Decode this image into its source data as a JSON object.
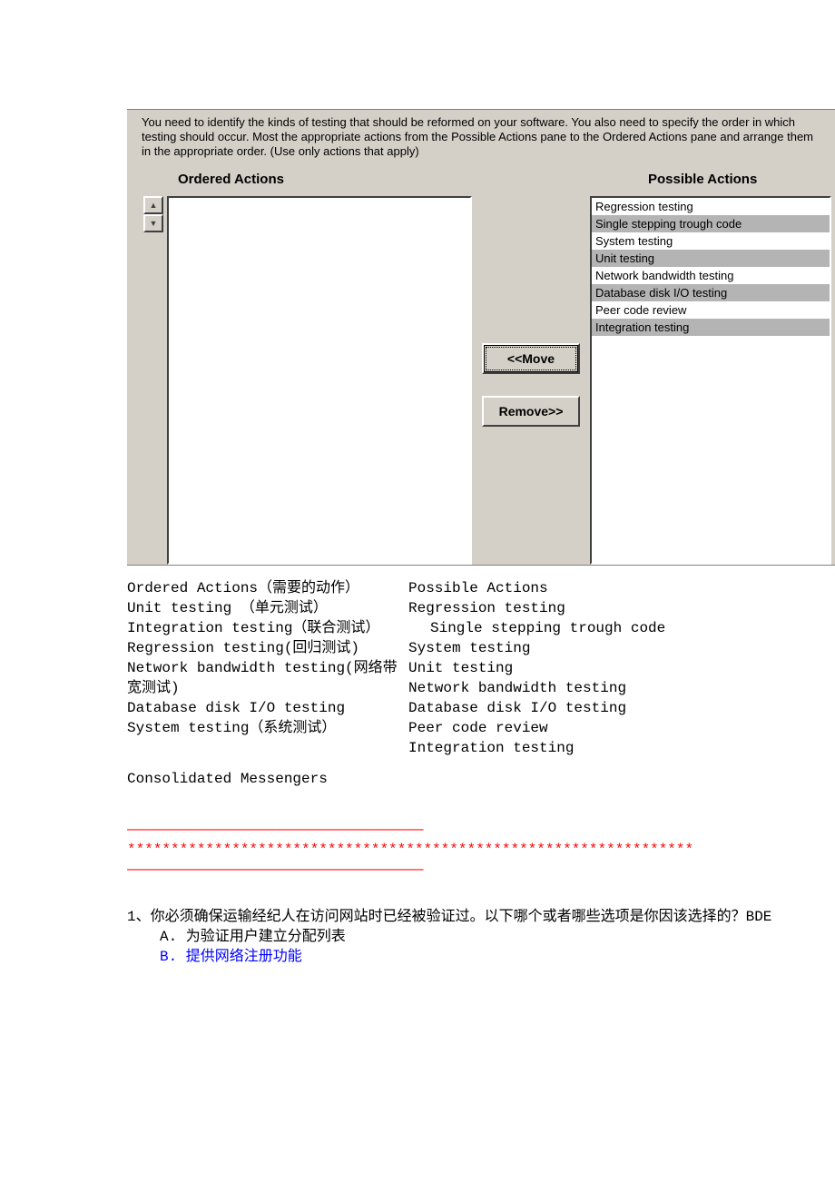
{
  "app": {
    "instructions": "You need to identify the kinds of testing that should be reformed on your software. You also need to specify the order in which testing should occur. Most the appropriate actions from the Possible Actions pane to the Ordered Actions pane and arrange them in the appropriate order. (Use only actions that apply)",
    "orderedHeader": "Ordered Actions",
    "possibleHeader": "Possible Actions",
    "moveLabel": "<<Move",
    "removeLabel": "Remove>>",
    "possible": [
      {
        "label": "Regression testing",
        "selected": false
      },
      {
        "label": "Single stepping trough code",
        "selected": true
      },
      {
        "label": "System testing",
        "selected": false
      },
      {
        "label": "Unit testing",
        "selected": true
      },
      {
        "label": "Network bandwidth testing",
        "selected": false
      },
      {
        "label": "Database disk I/O testing",
        "selected": true
      },
      {
        "label": "Peer code review",
        "selected": false
      },
      {
        "label": "Integration testing",
        "selected": true
      }
    ]
  },
  "doc": {
    "left": [
      "Ordered Actions（需要的动作）",
      "Unit testing （单元测试）",
      "Integration testing（联合测试）",
      "Regression testing(回归测试)",
      "Network bandwidth testing(网络带宽测试)",
      "Database disk I/O testing",
      "System testing（系统测试）"
    ],
    "right": [
      "Possible Actions",
      "Regression testing",
      "  Single stepping trough code",
      "System testing",
      "Unit testing",
      "Network bandwidth  testing",
      "Database disk I/O testing",
      "Peer code review",
      "Integration testing"
    ],
    "consolidated": "Consolidated Messengers",
    "sepDash": "——————————————————————————————————",
    "sepStar": "*****************************************************************",
    "question": "1、你必须确保运输经纪人在访问网站时已经被验证过。以下哪个或者哪些选项是你因该选择的？BDE",
    "optA": "A. 为验证用户建立分配列表",
    "optB": "B. 提供网络注册功能"
  }
}
